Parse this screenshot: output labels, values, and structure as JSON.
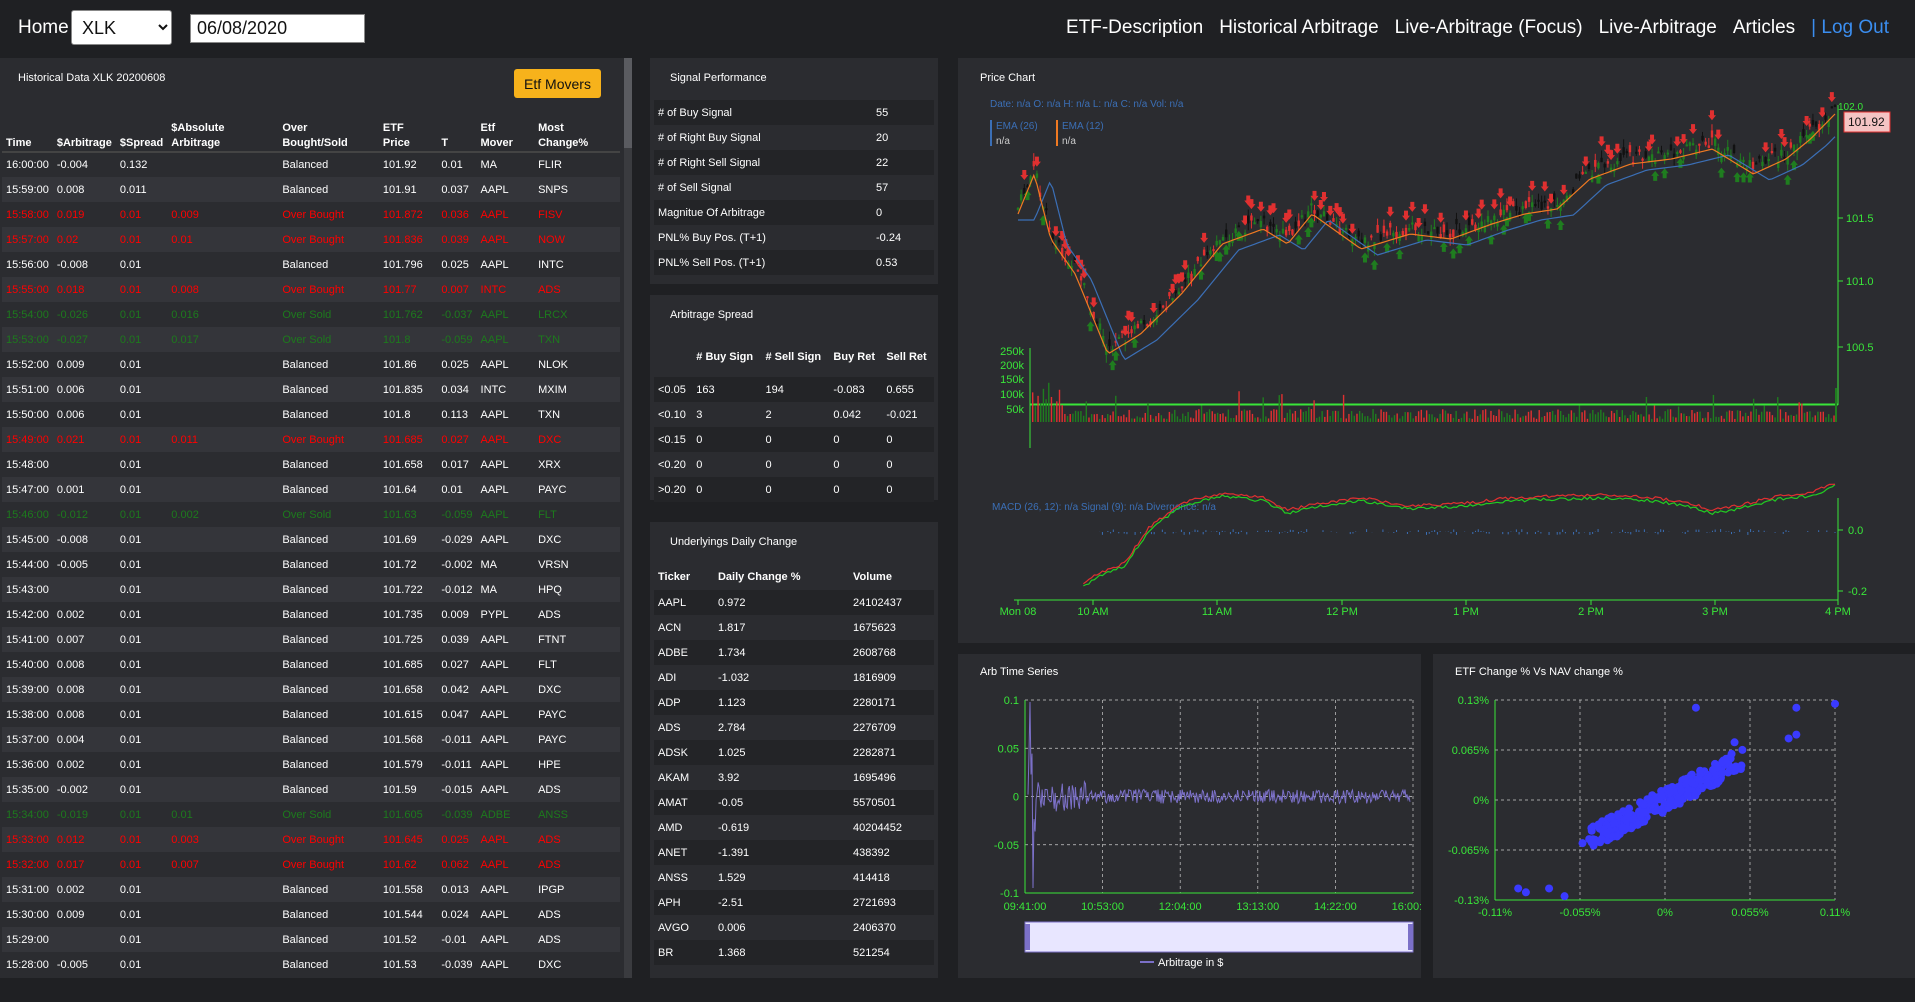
{
  "nav": {
    "home": "Home",
    "ticker": "XLK",
    "date": "06/08/2020",
    "links": [
      "ETF-Description",
      "Historical Arbitrage",
      "Live-Arbitrage (Focus)",
      "Live-Arbitrage",
      "Articles"
    ],
    "logout": "| Log Out"
  },
  "hist": {
    "title": "Historical Data XLK 20200608",
    "movers_label": "Etf Movers",
    "headers": [
      "Time",
      "$Arbitrage",
      "$Spread",
      "$Absolute Arbitrage",
      "Over Bought/Sold",
      "ETF Price",
      "T",
      "Etf Mover",
      "Most Change%"
    ],
    "rows": [
      [
        "16:00:00",
        "-0.004",
        "0.132",
        "",
        "Balanced",
        "101.92",
        "0.01",
        "MA",
        "FLIR"
      ],
      [
        "15:59:00",
        "0.008",
        "0.011",
        "",
        "Balanced",
        "101.91",
        "0.037",
        "AAPL",
        "SNPS"
      ],
      [
        "15:58:00",
        "0.019",
        "0.01",
        "0.009",
        "Over Bought",
        "101.872",
        "0.036",
        "AAPL",
        "FISV"
      ],
      [
        "15:57:00",
        "0.02",
        "0.01",
        "0.01",
        "Over Bought",
        "101.836",
        "0.039",
        "AAPL",
        "NOW"
      ],
      [
        "15:56:00",
        "-0.008",
        "0.01",
        "",
        "Balanced",
        "101.796",
        "0.025",
        "AAPL",
        "INTC"
      ],
      [
        "15:55:00",
        "0.018",
        "0.01",
        "0.008",
        "Over Bought",
        "101.77",
        "0.007",
        "INTC",
        "ADS"
      ],
      [
        "15:54:00",
        "-0.026",
        "0.01",
        "0.016",
        "Over Sold",
        "101.762",
        "-0.037",
        "AAPL",
        "LRCX"
      ],
      [
        "15:53:00",
        "-0.027",
        "0.01",
        "0.017",
        "Over Sold",
        "101.8",
        "-0.059",
        "AAPL",
        "TXN"
      ],
      [
        "15:52:00",
        "0.009",
        "0.01",
        "",
        "Balanced",
        "101.86",
        "0.025",
        "AAPL",
        "NLOK"
      ],
      [
        "15:51:00",
        "0.006",
        "0.01",
        "",
        "Balanced",
        "101.835",
        "0.034",
        "INTC",
        "MXIM"
      ],
      [
        "15:50:00",
        "0.006",
        "0.01",
        "",
        "Balanced",
        "101.8",
        "0.113",
        "AAPL",
        "TXN"
      ],
      [
        "15:49:00",
        "0.021",
        "0.01",
        "0.011",
        "Over Bought",
        "101.685",
        "0.027",
        "AAPL",
        "DXC"
      ],
      [
        "15:48:00",
        "",
        "0.01",
        "",
        "Balanced",
        "101.658",
        "0.017",
        "AAPL",
        "XRX"
      ],
      [
        "15:47:00",
        "0.001",
        "0.01",
        "",
        "Balanced",
        "101.64",
        "0.01",
        "AAPL",
        "PAYC"
      ],
      [
        "15:46:00",
        "-0.012",
        "0.01",
        "0.002",
        "Over Sold",
        "101.63",
        "-0.059",
        "AAPL",
        "FLT"
      ],
      [
        "15:45:00",
        "-0.008",
        "0.01",
        "",
        "Balanced",
        "101.69",
        "-0.029",
        "AAPL",
        "DXC"
      ],
      [
        "15:44:00",
        "-0.005",
        "0.01",
        "",
        "Balanced",
        "101.72",
        "-0.002",
        "MA",
        "VRSN"
      ],
      [
        "15:43:00",
        "",
        "0.01",
        "",
        "Balanced",
        "101.722",
        "-0.012",
        "MA",
        "HPQ"
      ],
      [
        "15:42:00",
        "0.002",
        "0.01",
        "",
        "Balanced",
        "101.735",
        "0.009",
        "PYPL",
        "ADS"
      ],
      [
        "15:41:00",
        "0.007",
        "0.01",
        "",
        "Balanced",
        "101.725",
        "0.039",
        "AAPL",
        "FTNT"
      ],
      [
        "15:40:00",
        "0.008",
        "0.01",
        "",
        "Balanced",
        "101.685",
        "0.027",
        "AAPL",
        "FLT"
      ],
      [
        "15:39:00",
        "0.008",
        "0.01",
        "",
        "Balanced",
        "101.658",
        "0.042",
        "AAPL",
        "DXC"
      ],
      [
        "15:38:00",
        "0.008",
        "0.01",
        "",
        "Balanced",
        "101.615",
        "0.047",
        "AAPL",
        "PAYC"
      ],
      [
        "15:37:00",
        "0.004",
        "0.01",
        "",
        "Balanced",
        "101.568",
        "-0.011",
        "AAPL",
        "PAYC"
      ],
      [
        "15:36:00",
        "0.002",
        "0.01",
        "",
        "Balanced",
        "101.579",
        "-0.011",
        "AAPL",
        "HPE"
      ],
      [
        "15:35:00",
        "-0.002",
        "0.01",
        "",
        "Balanced",
        "101.59",
        "-0.015",
        "AAPL",
        "ADS"
      ],
      [
        "15:34:00",
        "-0.019",
        "0.01",
        "0.01",
        "Over Sold",
        "101.605",
        "-0.039",
        "ADBE",
        "ANSS"
      ],
      [
        "15:33:00",
        "0.012",
        "0.01",
        "0.003",
        "Over Bought",
        "101.645",
        "0.025",
        "AAPL",
        "ADS"
      ],
      [
        "15:32:00",
        "0.017",
        "0.01",
        "0.007",
        "Over Bought",
        "101.62",
        "0.062",
        "AAPL",
        "ADS"
      ],
      [
        "15:31:00",
        "0.002",
        "0.01",
        "",
        "Balanced",
        "101.558",
        "0.013",
        "AAPL",
        "IPGP"
      ],
      [
        "15:30:00",
        "0.009",
        "0.01",
        "",
        "Balanced",
        "101.544",
        "0.024",
        "AAPL",
        "ADS"
      ],
      [
        "15:29:00",
        "",
        "0.01",
        "",
        "Balanced",
        "101.52",
        "-0.01",
        "AAPL",
        "ADS"
      ],
      [
        "15:28:00",
        "-0.005",
        "0.01",
        "",
        "Balanced",
        "101.53",
        "-0.039",
        "AAPL",
        "DXC"
      ]
    ]
  },
  "signal": {
    "title": "Signal Performance",
    "rows": [
      [
        "# of Buy Signal",
        "55"
      ],
      [
        "# of Right Buy Signal",
        "20"
      ],
      [
        "# of Right Sell Signal",
        "22"
      ],
      [
        "# of Sell Signal",
        "57"
      ],
      [
        "Magnitue Of Arbitrage",
        "0"
      ],
      [
        "PNL% Buy Pos. (T+1)",
        "-0.24"
      ],
      [
        "PNL% Sell Pos. (T+1)",
        "0.53"
      ]
    ]
  },
  "spread": {
    "title": "Arbitrage Spread",
    "headers": [
      "",
      "# Buy Sign",
      "# Sell Sign",
      "Buy Ret",
      "Sell Ret"
    ],
    "rows": [
      [
        "<0.05",
        "163",
        "194",
        "-0.083",
        "0.655"
      ],
      [
        "<0.10",
        "3",
        "2",
        "0.042",
        "-0.021"
      ],
      [
        "<0.15",
        "0",
        "0",
        "0",
        "0"
      ],
      [
        "<0.20",
        "0",
        "0",
        "0",
        "0"
      ],
      [
        ">0.20",
        "0",
        "0",
        "0",
        "0"
      ]
    ]
  },
  "underlyings": {
    "title": "Underlyings Daily Change",
    "headers": [
      "Ticker",
      "Daily Change %",
      "Volume"
    ],
    "rows": [
      [
        "AAPL",
        "0.972",
        "24102437"
      ],
      [
        "ACN",
        "1.817",
        "1675623"
      ],
      [
        "ADBE",
        "1.734",
        "2608768"
      ],
      [
        "ADI",
        "-1.032",
        "1816909"
      ],
      [
        "ADP",
        "1.123",
        "2280171"
      ],
      [
        "ADS",
        "2.784",
        "2276709"
      ],
      [
        "ADSK",
        "1.025",
        "2282871"
      ],
      [
        "AKAM",
        "3.92",
        "1695496"
      ],
      [
        "AMAT",
        "-0.05",
        "5570501"
      ],
      [
        "AMD",
        "-0.619",
        "40204452"
      ],
      [
        "ANET",
        "-1.391",
        "438392"
      ],
      [
        "ANSS",
        "1.529",
        "414418"
      ],
      [
        "APH",
        "-2.51",
        "2721693"
      ],
      [
        "AVGO",
        "0.006",
        "2406370"
      ],
      [
        "BR",
        "1.368",
        "521254"
      ]
    ]
  },
  "price_chart": {
    "title": "Price Chart",
    "ohlc_label": "Date: n/a O: n/a H: n/a L: n/a C: n/a Vol: n/a",
    "ema26": "EMA (26)",
    "ema12": "EMA (12)",
    "na": "n/a",
    "last_price": "101.92",
    "price_ticks": [
      "102.0",
      "101.5",
      "101.0",
      "100.5"
    ],
    "vol_ticks": [
      "250k",
      "200k",
      "150k",
      "100k",
      "50k"
    ],
    "macd_label": "MACD (26, 12): n/a Signal (9): n/a Divergence: n/a",
    "macd_ticks": [
      "0.0",
      "-0.2"
    ],
    "time_ticks": [
      "Mon 08",
      "10 AM",
      "11 AM",
      "12 PM",
      "1 PM",
      "2 PM",
      "3 PM",
      "4 PM"
    ],
    "colors": {
      "up": "#1f7d1f",
      "down": "#e03030",
      "ema26": "#3b6fb6",
      "ema12": "#f07a22",
      "axis": "#39e639"
    }
  },
  "chart_data": [
    {
      "type": "line",
      "title": "Arb Time Series",
      "series": [
        {
          "name": "Arbitrage in $"
        }
      ],
      "x_ticks": [
        "09:41:00",
        "10:53:00",
        "12:04:00",
        "13:13:00",
        "14:22:00",
        "16:00:00"
      ],
      "y_ticks": [
        "0.1",
        "0.05",
        "0",
        "-0.05",
        "-0.1"
      ],
      "ylim": [
        -0.1,
        0.1
      ],
      "color": "#7b70c8"
    },
    {
      "type": "scatter",
      "title": "ETF Change % Vs NAV change %",
      "x_ticks": [
        "-0.11%",
        "-0.055%",
        "0%",
        "0.055%",
        "0.11%"
      ],
      "y_ticks": [
        "0.13%",
        "0.065%",
        "0%",
        "-0.065%",
        "-0.13%"
      ],
      "xlim": [
        -0.11,
        0.11
      ],
      "ylim": [
        -0.13,
        0.13
      ],
      "color": "#3a3aff"
    }
  ]
}
